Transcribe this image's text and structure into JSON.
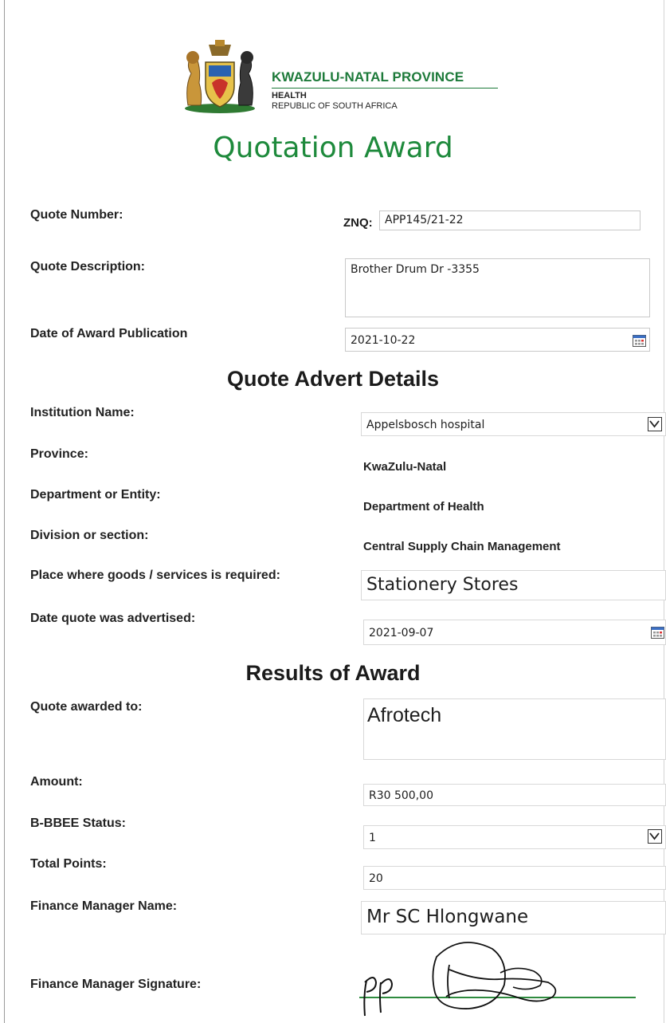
{
  "header": {
    "province": "KWAZULU-NATAL PROVINCE",
    "department": "HEALTH",
    "country": "REPUBLIC OF SOUTH AFRICA",
    "title": "Quotation Award"
  },
  "quote": {
    "number_label": "Quote Number:",
    "number_prefix": "ZNQ:",
    "number_value": "APP145/21-22",
    "description_label": "Quote Description:",
    "description_value": "Brother Drum Dr -3355",
    "award_date_label": "Date of Award Publication",
    "award_date_value": "2021-10-22"
  },
  "advert": {
    "heading": "Quote Advert Details",
    "institution_label": "Institution Name:",
    "institution_value": "Appelsbosch hospital",
    "province_label": "Province:",
    "province_value": "KwaZulu-Natal",
    "department_label": "Department or Entity:",
    "department_value": "Department of Health",
    "division_label": "Division or section:",
    "division_value": "Central Supply Chain Management",
    "place_label": "Place where goods /  services is required:",
    "place_value": "Stationery Stores",
    "advertised_label": "Date quote was advertised:",
    "advertised_value": "2021-09-07"
  },
  "results": {
    "heading": "Results of Award",
    "awarded_label": "Quote awarded to:",
    "awarded_value": "Afrotech",
    "amount_label": "Amount:",
    "amount_value": "R30 500,00",
    "bbbee_label": "B-BBEE Status:",
    "bbbee_value": "1",
    "points_label": "Total Points:",
    "points_value": "20",
    "manager_name_label": "Finance Manager Name:",
    "manager_name_value": "Mr SC Hlongwane",
    "manager_signature_label": "Finance Manager Signature:",
    "signature_mark": "pp"
  },
  "colors": {
    "title_green": "#1e8a3c",
    "province_green": "#1d7a3a",
    "signature_line": "#2e8b3e"
  }
}
